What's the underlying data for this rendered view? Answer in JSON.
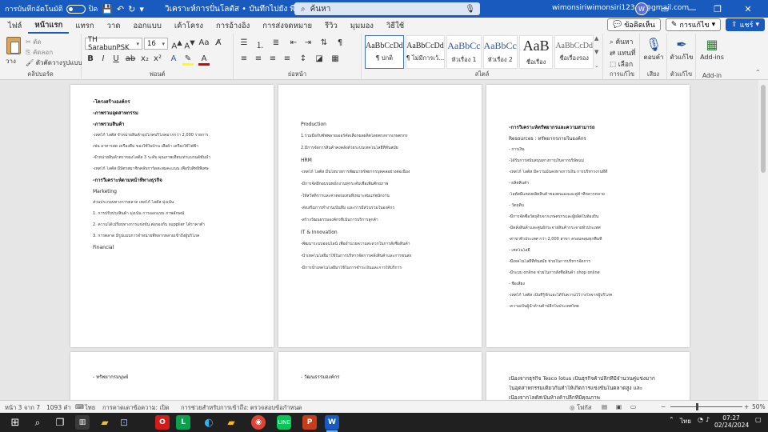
{
  "titlebar": {
    "autosave_label": "การบันทึกอัตโนมัติ",
    "autosave_state": "ปิด",
    "doc_title": "วิเคราะห์การปั่นโลตัส • บันทึกไปยัง พีซีนี้",
    "search_placeholder": "ค้นหา",
    "account_email": "wimonsiriwimonsiri12345@gmail.com",
    "avatar_initial": "W"
  },
  "tabs": [
    {
      "label": "ไฟล์",
      "active": false
    },
    {
      "label": "หน้าแรก",
      "active": true
    },
    {
      "label": "แทรก",
      "active": false
    },
    {
      "label": "วาด",
      "active": false
    },
    {
      "label": "ออกแบบ",
      "active": false
    },
    {
      "label": "เค้าโครง",
      "active": false
    },
    {
      "label": "การอ้างอิง",
      "active": false
    },
    {
      "label": "การส่งจดหมาย",
      "active": false
    },
    {
      "label": "รีวิว",
      "active": false
    },
    {
      "label": "มุมมอง",
      "active": false
    },
    {
      "label": "วิธีใช้",
      "active": false
    }
  ],
  "ribbon_buttons": {
    "comments": "ข้อคิดเห็น",
    "editing": "การแก้ไข",
    "share": "แชร์"
  },
  "clipboard": {
    "paste": "วาง",
    "cut": "ตัด",
    "copy": "คัดลอก",
    "format_painter": "ตัวคัดวางรูปแบบ",
    "label": "คลิปบอร์ด"
  },
  "font": {
    "name": "TH SarabunPSK",
    "size": "16",
    "label": "ฟอนต์"
  },
  "paragraph": {
    "label": "ย่อหน้า"
  },
  "styles": {
    "label": "สไตล์",
    "items": [
      {
        "preview": "AaBbCcDd",
        "name": "¶ ปกติ",
        "selected": true
      },
      {
        "preview": "AaBbCcDd",
        "name": "¶ ไม่มีการเว้...",
        "selected": false
      },
      {
        "preview": "AaBbCc",
        "name": "หัวเรื่อง 1",
        "selected": false
      },
      {
        "preview": "AaBbCc",
        "name": "หัวเรื่อง 2",
        "selected": false
      },
      {
        "preview": "AaB",
        "name": "ชื่อเรื่อง",
        "selected": false
      },
      {
        "preview": "AaBbCcDd",
        "name": "ชื่อเรื่องรอง",
        "selected": false
      }
    ]
  },
  "editing": {
    "find": "ค้นหา",
    "replace": "แทนที่",
    "select": "เลือก",
    "label": "การแก้ไข"
  },
  "voice": {
    "dictate": "ตอบคำ",
    "label": "เสียง"
  },
  "editor": {
    "button": "ตัวแก้ไข",
    "label": "ตัวแก้ไข"
  },
  "addins": {
    "button": "Add-ins",
    "label": "Add-in"
  },
  "pages": [
    {
      "lines": [
        {
          "t": "-โครงสร้างองค์กร",
          "c": "h"
        },
        {
          "t": "-ภาพรวมอุตสาหกรรม",
          "c": "h"
        },
        {
          "t": "-ภาพรวมสินค้า",
          "c": "h"
        },
        {
          "t": "-เทสโก้ โลตัส จำหน่ายสินค้าอุปโภคบริโภคมากกว่า 2,000 รายการ",
          "c": ""
        },
        {
          "t": "เช่น อาหารสด เครื่องดื่ม ของใช้ในบ้าน เสื้อผ้า เครื่องใช้ไฟฟ้า",
          "c": ""
        },
        {
          "t": "-จำหน่ายสินค้าตราของโลตัส 3 ระดับ คุณภาพเทียบเท่าแบรนด์ชั้นนำ",
          "c": ""
        },
        {
          "t": "-เทสโก้ โลตัส มีบัตรสมาชิกคลับการ์ดสะสมคะแนน เพื่อรับสิทธิพิเศษ",
          "c": ""
        },
        {
          "t": "-การวิเคราะห์ตามหน้าที่ทางธุรกิจ",
          "c": "h"
        },
        {
          "t": "Marketing",
          "c": "sh"
        },
        {
          "t": "ส่วนประกอบทางการตลาด เทสโก้ โลตัส มุ่งเน้น",
          "c": ""
        },
        {
          "t": "1. การปรับปรุงสินค้า มุ่งเน้น การออกแบบ ภาพลักษณ์",
          "c": ""
        },
        {
          "t": "2. ความได้เปรียบทางการแข่งขัน ต่อรองกับ supplier ได้ราคาต่ำ",
          "c": ""
        },
        {
          "t": "3. การตลาด มีรูปแบบการจำหน่ายที่หลากหลายเข้าถึงผู้บริโภค",
          "c": ""
        },
        {
          "t": "Financial",
          "c": "sh"
        }
      ]
    },
    {
      "lines": [
        {
          "t": "Production",
          "c": "sh"
        },
        {
          "t": "1.ร่วมมือกับซัพพลายเออร์คัดเลือกผลผลิตโดยตรงจากเกษตรกร",
          "c": ""
        },
        {
          "t": "2.มีการจัดการสินค้าคงคลังด้วยระบบเทคโนโลยีที่ทันสมัย",
          "c": ""
        },
        {
          "t": "HRM",
          "c": "sh"
        },
        {
          "t": "-เทสโก้ โลตัส มีนโยบายการพัฒนาทรัพยากรบุคคลอย่างต่อเนื่อง",
          "c": ""
        },
        {
          "t": "-มีการจัดฝึกอบรมพนักงานทุกระดับเพื่อเพิ่มศักยภาพ",
          "c": ""
        },
        {
          "t": "-ให้สวัสดิการและค่าตอบแทนที่เหมาะสมแก่พนักงาน",
          "c": ""
        },
        {
          "t": "-ส่งเสริมการทำงานเป็นทีม และการมีส่วนร่วมในองค์กร",
          "c": ""
        },
        {
          "t": "-สร้างวัฒนธรรมองค์กรที่เน้นการบริการลูกค้า",
          "c": ""
        },
        {
          "t": "IT & Innovation",
          "c": "sh"
        },
        {
          "t": "-พัฒนาระบบออนไลน์ เพื่ออำนวยความสะดวกในการสั่งซื้อสินค้า",
          "c": ""
        },
        {
          "t": "-นำเทคโนโลยีมาใช้ในการบริหารจัดการคลังสินค้าและการขนส่ง",
          "c": ""
        },
        {
          "t": "-มีการนำเทคโนโลยีมาใช้ในการชำระเงินและการให้บริการ",
          "c": ""
        }
      ]
    },
    {
      "lines": [
        {
          "t": "-การวิเคราะห์ทรัพยากรและความสามารถ",
          "c": "h"
        },
        {
          "t": "Resources : ทรัพยากรภายในองค์กร",
          "c": "sh"
        },
        {
          "t": "- การเงิน",
          "c": ""
        },
        {
          "t": "-ได้รับการสนับสนุนทางการเงินจากบริษัทแม่",
          "c": ""
        },
        {
          "t": "-เทสโก้ โลตัส มีความมั่นคงทางการเงิน การบริหารงานที่ดี",
          "c": ""
        },
        {
          "t": "- ผลิตสินค้า",
          "c": ""
        },
        {
          "t": "-โลตัสมีแหล่งผลิตสินค้าของตนเองและคู่ค้าที่หลากหลาย",
          "c": ""
        },
        {
          "t": "- วัตถุดิบ",
          "c": ""
        },
        {
          "t": "-มีการจัดซื้อวัตถุดิบจากเกษตรกรและผู้ผลิตในท้องถิ่น",
          "c": ""
        },
        {
          "t": "-มีคลังสินค้าและศูนย์กระจายสินค้ากระจายทั่วประเทศ",
          "c": ""
        },
        {
          "t": "-สาขาทั่วประเทศ กว่า 2,000 สาขา ครอบคลุมทุกพื้นที่",
          "c": ""
        },
        {
          "t": "- เทคโนโลยี",
          "c": ""
        },
        {
          "t": "-มีเทคโนโลยีที่ทันสมัย ช่วยในการบริหารจัดการ",
          "c": ""
        },
        {
          "t": "-มีระบบ online ช่วยในการสั่งซื้อสินค้า shop online",
          "c": ""
        },
        {
          "t": "- ชื่อเสียง",
          "c": ""
        },
        {
          "t": "-เทสโก้ โลตัส เป็นที่รู้จักและได้รับความไว้วางใจจากผู้บริโภค",
          "c": ""
        },
        {
          "t": "-ความเป็นผู้นำด้านค้าปลีกในประเทศไทย",
          "c": ""
        }
      ]
    },
    {
      "lines": [
        {
          "t": "- ทรัพยากรมนุษย์",
          "c": "sh"
        }
      ]
    },
    {
      "lines": [
        {
          "t": "- วัฒนธรรมองค์กร",
          "c": "sh"
        }
      ]
    },
    {
      "lines": [
        {
          "t": "เนื่องจากธุรกิจ Tesco lotus เป็นธุรกิจค้าปลีกที่มีจำนวนคู่แข่งมาก",
          "c": "big"
        },
        {
          "t": "ในอุตสาหกรรมเดียวกันทำให้เกิดการแข่งขันในตลาดสูง และ",
          "c": "big"
        },
        {
          "t": "เนื่องจากโลตัสเป็นห้างค้าปลีกที่มีคุณภาพ",
          "c": "big"
        }
      ]
    }
  ],
  "status": {
    "page": "หน้า 3 จาก 7",
    "words": "1093 คำ",
    "lang": "ไทย",
    "text_predictions": "การคาดเดาข้อความ: เปิด",
    "accessibility": "การช่วยสำหรับการเข้าถึง: ตรวจสอบข้อกำหนด",
    "focus": "โฟกัส",
    "zoom": "50%"
  },
  "taskbar": {
    "tray_lang": "ไทย",
    "time": "07:27",
    "date": "02/24/2024"
  }
}
